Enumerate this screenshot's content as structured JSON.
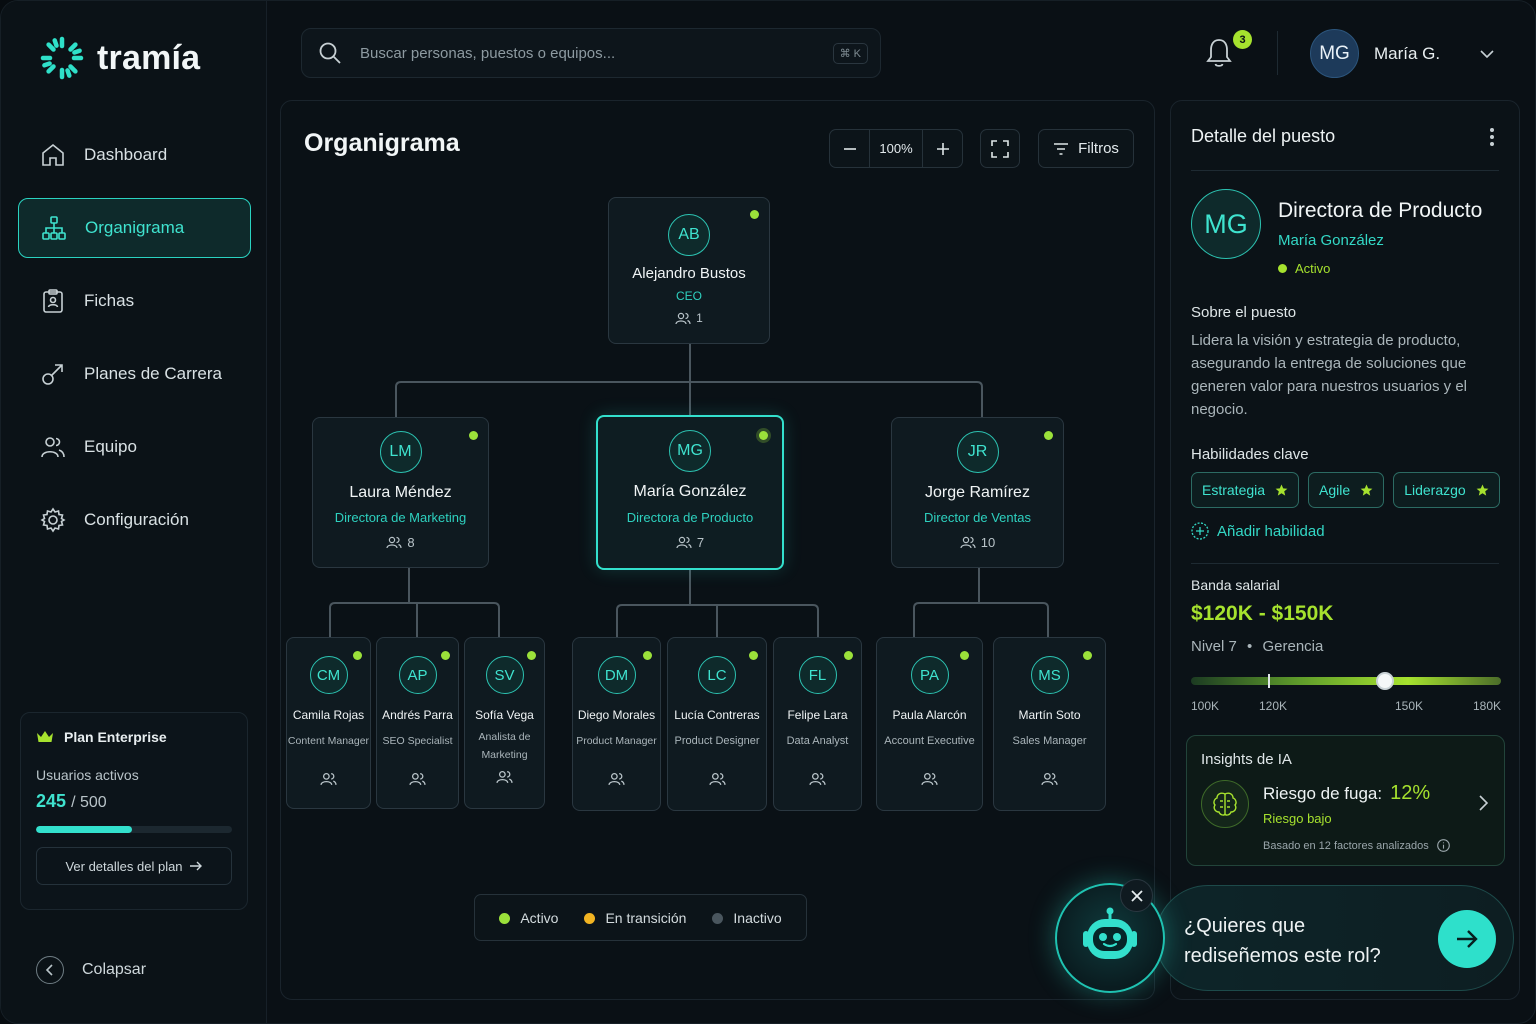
{
  "app": {
    "name": "tramía"
  },
  "sidebar": {
    "items": [
      {
        "label": "Dashboard",
        "icon": "home-icon"
      },
      {
        "label": "Organigrama",
        "icon": "org-chart-icon",
        "active": true
      },
      {
        "label": "Fichas",
        "icon": "clipboard-icon"
      },
      {
        "label": "Planes de Carrera",
        "icon": "growth-arrow-icon"
      },
      {
        "label": "Equipo",
        "icon": "users-icon"
      },
      {
        "label": "Configuración",
        "icon": "gear-icon"
      }
    ],
    "plan": {
      "title": "Plan Enterprise",
      "users_label": "Usuarios activos",
      "users_active": "245",
      "users_total": "/ 500",
      "progress_fraction": 0.49,
      "button_label": "Ver detalles del plan"
    },
    "collapse_label": "Colapsar"
  },
  "topbar": {
    "search_placeholder": "Buscar personas, puestos o equipos...",
    "shortcut": "⌘ K",
    "notifications_count": "3",
    "user_initials": "MG",
    "user_name": "María G."
  },
  "orgchart": {
    "title": "Organigrama",
    "zoom": "100%",
    "filters_label": "Filtros",
    "root": {
      "initials": "AB",
      "name": "Alejandro Bustos",
      "role": "CEO",
      "count": "1",
      "status": "active"
    },
    "level1": [
      {
        "initials": "LM",
        "name": "Laura Méndez",
        "role": "Directora de Marketing",
        "count": "8",
        "status": "active"
      },
      {
        "initials": "MG",
        "name": "María González",
        "role": "Directora de Producto",
        "count": "7",
        "status": "active",
        "selected": true
      },
      {
        "initials": "JR",
        "name": "Jorge Ramírez",
        "role": "Director de Ventas",
        "count": "10",
        "status": "active"
      }
    ],
    "level2": [
      {
        "initials": "CM",
        "name": "Camila Rojas",
        "role": "Content Manager",
        "status": "active"
      },
      {
        "initials": "AP",
        "name": "Andrés Parra",
        "role": "SEO Specialist",
        "status": "active"
      },
      {
        "initials": "SV",
        "name": "Sofía Vega",
        "role": "Analista de Marketing",
        "status": "active"
      },
      {
        "initials": "DM",
        "name": "Diego Morales",
        "role": "Product Manager",
        "status": "active"
      },
      {
        "initials": "LC",
        "name": "Lucía Contreras",
        "role": "Product Designer",
        "status": "active"
      },
      {
        "initials": "FL",
        "name": "Felipe Lara",
        "role": "Data Analyst",
        "status": "active"
      },
      {
        "initials": "PA",
        "name": "Paula Alarcón",
        "role": "Account Executive",
        "status": "active"
      },
      {
        "initials": "MS",
        "name": "Martín Soto",
        "role": "Sales Manager",
        "status": "active"
      }
    ],
    "legend": [
      {
        "label": "Activo",
        "color": "#9be13a"
      },
      {
        "label": "En transición",
        "color": "#f2b422"
      },
      {
        "label": "Inactivo",
        "color": "#4a565e"
      }
    ]
  },
  "detail": {
    "header": "Detalle del puesto",
    "initials": "MG",
    "title": "Directora de Producto",
    "person": "María González",
    "status": "Activo",
    "about_label": "Sobre el puesto",
    "about_text": "Lidera la visión y estrategia de producto, asegurando la entrega de soluciones que generen valor para nuestros usuarios y el negocio.",
    "skills_label": "Habilidades clave",
    "skills": [
      "Estrategia",
      "Agile",
      "Liderazgo"
    ],
    "add_skill_label": "Añadir habilidad",
    "salary_label": "Banda salarial",
    "salary_range": "$120K - $150K",
    "level": "Nivel 7",
    "area": "Gerencia",
    "slider": {
      "labels": [
        "100K",
        "120K",
        "150K",
        "180K"
      ],
      "low": 120,
      "high": 150,
      "min": 100,
      "max": 180
    },
    "insights": {
      "title": "Insights de IA",
      "risk_label": "Riesgo de fuga:",
      "risk_value": "12%",
      "risk_level": "Riesgo bajo",
      "footnote": "Basado en 12 factores analizados"
    }
  },
  "assistant": {
    "message": "¿Quieres que rediseñemos este rol?"
  },
  "colors": {
    "accent": "#33e0cd",
    "lime": "#a6e22e",
    "background": "#0a1015"
  }
}
